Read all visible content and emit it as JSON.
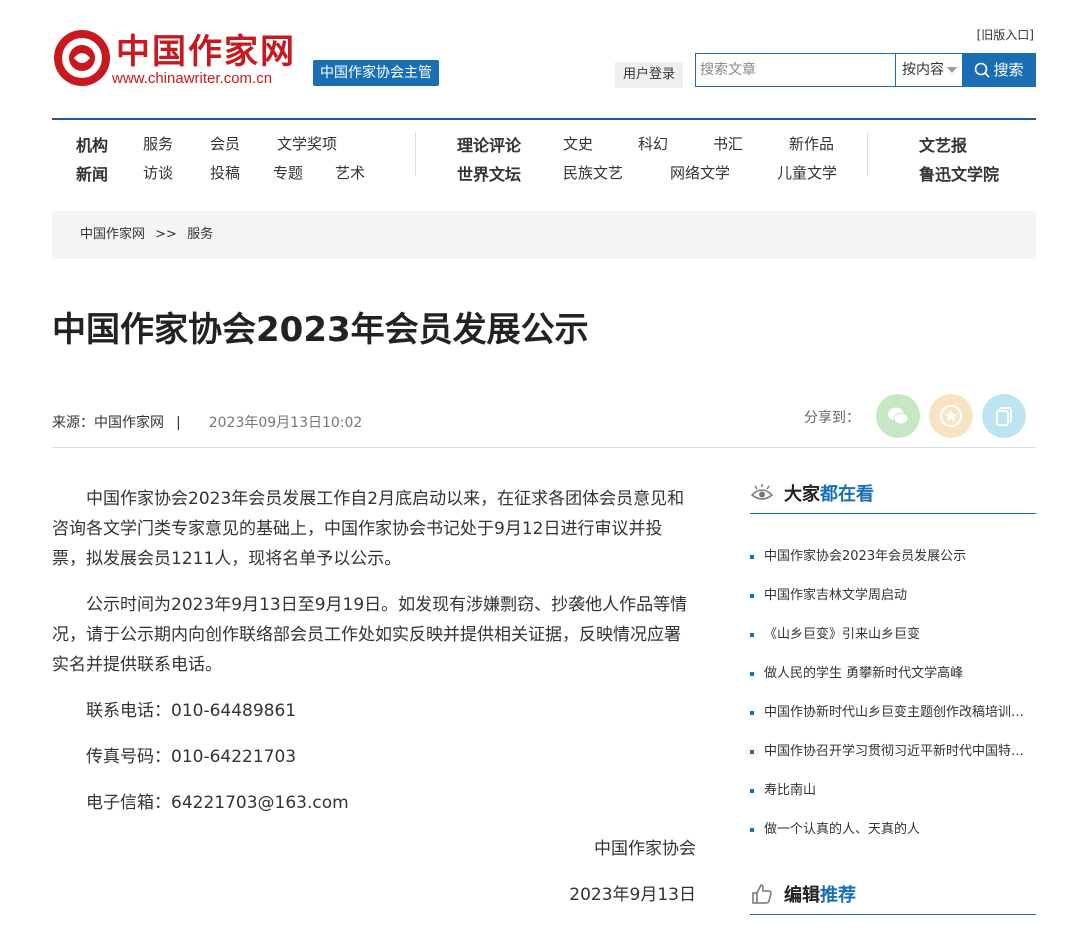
{
  "header": {
    "logo_text": "中国作家网",
    "logo_url": "www.chinawriter.com.cn",
    "supervisor": "中国作家协会主管",
    "old_version": "[旧版入口]",
    "login": "用户登录",
    "search_placeholder": "搜索文章",
    "search_scope": "按内容",
    "search_button": "搜索"
  },
  "nav": {
    "row1": [
      "机构",
      "服务",
      "会员",
      "文学奖项",
      "理论评论",
      "文史",
      "科幻",
      "书汇",
      "新作品",
      "文艺报"
    ],
    "row2": [
      "新闻",
      "访谈",
      "投稿",
      "专题",
      "艺术",
      "世界文坛",
      "民族文艺",
      "网络文学",
      "儿童文学",
      "鲁迅文学院"
    ]
  },
  "breadcrumb": {
    "home": "中国作家网",
    "separator": ">>",
    "current": "服务"
  },
  "article": {
    "title": "中国作家协会2023年会员发展公示",
    "source": "来源：中国作家网",
    "separator": "|",
    "datetime": "2023年09月13日10:02",
    "share_label": "分享到：",
    "paragraphs": [
      "中国作家协会2023年会员发展工作自2月底启动以来，在征求各团体会员意见和咨询各文学门类专家意见的基础上，中国作家协会书记处于9月12日进行审议并投票，拟发展会员1211人，现将名单予以公示。",
      "公示时间为2023年9月13日至9月19日。如发现有涉嫌剽窃、抄袭他人作品等情况，请于公示期内向创作联络部会员工作处如实反映并提供相关证据，反映情况应署实名并提供联系电话。"
    ],
    "phone": "联系电话：010-64489861",
    "fax": "传真号码：010-64221703",
    "email": "电子信箱：64221703@163.com",
    "signature": "中国作家协会",
    "sign_date": "2023年9月13日"
  },
  "sidebar": {
    "popular_title_a": "大家",
    "popular_title_b": "都在看",
    "popular_items": [
      "中国作家协会2023年会员发展公示",
      "中国作家吉林文学周启动",
      "《山乡巨变》引来山乡巨变",
      "做人民的学生 勇攀新时代文学高峰",
      "中国作协新时代山乡巨变主题创作改稿培训班开班",
      "中国作协召开学习贯彻习近平新时代中国特色社会主义思想主题教育",
      "寿比南山",
      "做一个认真的人、天真的人"
    ],
    "recommend_title_a": "编辑",
    "recommend_title_b": "推荐"
  },
  "colors": {
    "brand_red": "#c9191e",
    "brand_blue": "#1a6eb4"
  }
}
